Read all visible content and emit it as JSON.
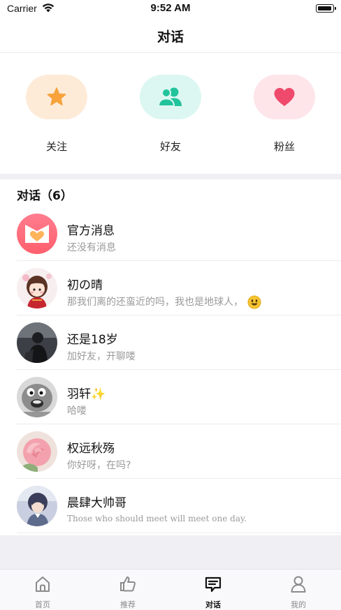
{
  "status_bar": {
    "carrier": "Carrier",
    "time": "9:52 AM"
  },
  "header": {
    "title": "对话"
  },
  "quick_actions": [
    {
      "label": "关注",
      "icon": "star-icon",
      "bg": "#fdebd8",
      "color": "#f7a23b"
    },
    {
      "label": "好友",
      "icon": "friends-icon",
      "bg": "#dcf7f1",
      "color": "#21c39c"
    },
    {
      "label": "粉丝",
      "icon": "heart-icon",
      "bg": "#fde5ea",
      "color": "#ef4a6b"
    }
  ],
  "conversations_header": "对话（6）",
  "conversations": [
    {
      "name": "官方消息",
      "message": "还没有消息",
      "avatar": "official-logo-avatar"
    },
    {
      "name": "初の晴",
      "message": "那我们离的还蛮近的吗，我也是地球人，",
      "avatar": "anime-girl-avatar",
      "emoji": "smiley-emoji-icon"
    },
    {
      "name": "还是18岁",
      "message": "加好友，开聊喽",
      "avatar": "dark-photo-avatar"
    },
    {
      "name": "羽轩",
      "name_suffix": "✨",
      "message": "哈喽",
      "avatar": "bw-cartoon-avatar"
    },
    {
      "name": "权远秋殇",
      "message": "你好呀，在吗?",
      "avatar": "rose-avatar"
    },
    {
      "name": "晨肆大帅哥",
      "message": "Those who should meet will meet one day.",
      "avatar": "anime-boy-avatar"
    }
  ],
  "tab_bar": [
    {
      "label": "首页",
      "icon": "home-icon",
      "active": false
    },
    {
      "label": "推荐",
      "icon": "thumbs-up-icon",
      "active": false
    },
    {
      "label": "对话",
      "icon": "chat-icon",
      "active": true
    },
    {
      "label": "我的",
      "icon": "profile-icon",
      "active": false
    }
  ],
  "colors": {
    "accent_text": "#111111",
    "secondary_text": "#9a9a9a",
    "divider": "#ececf0",
    "section_bg": "#efeff4"
  }
}
